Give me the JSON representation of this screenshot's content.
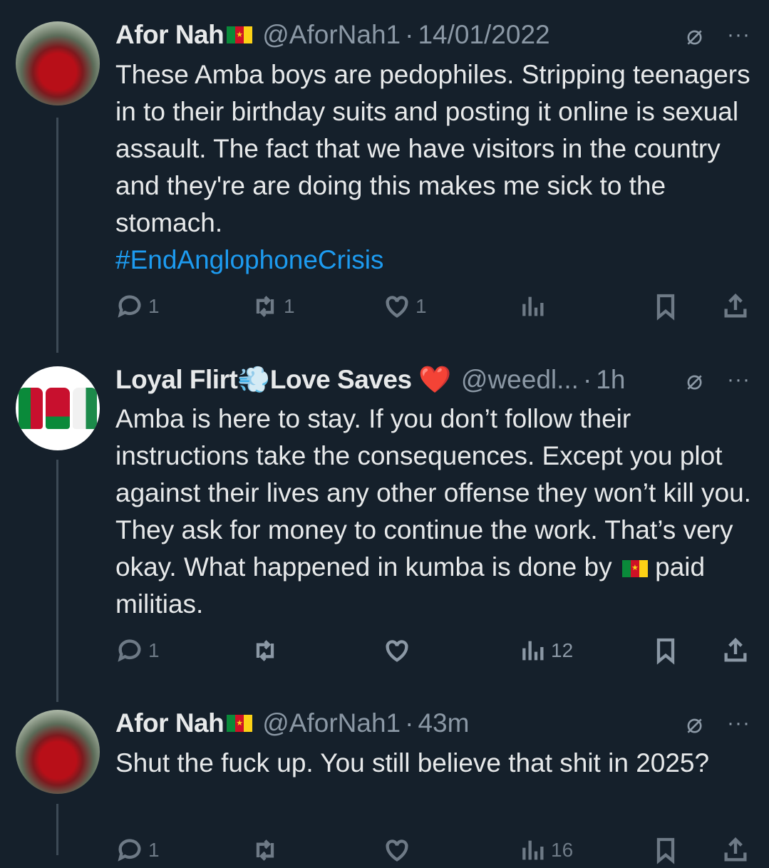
{
  "tweets": [
    {
      "name": "Afor Nah",
      "handle": "@AforNah1",
      "time": "14/01/2022",
      "text": "These Amba boys are pedophiles. Stripping teenagers in to their birthday suits and posting it online is sexual assault. The fact that we have visitors in the country and they're are doing this makes me sick to the stomach.",
      "hashtag": "#EndAnglophoneCrisis",
      "replies": "1",
      "retweets": "1",
      "likes": "1",
      "views": ""
    },
    {
      "name_part1": "Loyal Flirt",
      "name_part2": "Love Saves",
      "name_emoji1": "💨",
      "name_emoji2": "❤️",
      "handle": "@weedl...",
      "time": "1h",
      "text_part1": "Amba is here to stay. If you don’t follow their instructions take the consequences. Except you plot against their lives any other offense they won’t kill you. They ask for money to continue the work. That’s very okay. What happened in kumba is done by ",
      "text_part2": " paid militias.",
      "replies": "1",
      "retweets": "",
      "likes": "",
      "views": "12"
    },
    {
      "name": "Afor Nah",
      "handle": "@AforNah1",
      "time": "43m",
      "text": "Shut the fuck up. You still believe that shit in 2025?",
      "replies": "1",
      "retweets": "",
      "likes": "",
      "views": "16"
    }
  ],
  "separator": "·",
  "more_glyph": "···",
  "colors": {
    "background": "#15202b",
    "text": "#e7e9ea",
    "muted": "#8b98a5",
    "link": "#1d9bf0",
    "heart": "#e0245e"
  }
}
